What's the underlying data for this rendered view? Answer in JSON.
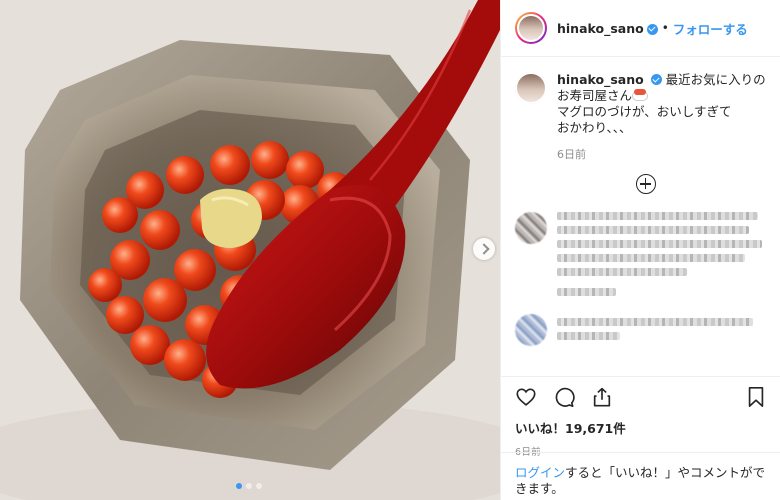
{
  "post": {
    "username": "hinako_sano",
    "follow_label": "フォローする",
    "separator": "•",
    "caption_line1": "最近お気に入りのお寿司屋さん",
    "caption_line2": "マグロのづけが、おいしすぎて",
    "caption_line3": "おかわり、、、",
    "caption_age": "6日前",
    "likes": "いいね！19,671件",
    "date": "6日前",
    "login_link": "ログイン",
    "login_text": "すると「いいね！」やコメントができます。",
    "carousel": {
      "total": 3,
      "current": 1
    }
  },
  "icons": {
    "verified": "verified-badge-icon",
    "like": "heart-icon",
    "comment": "comment-bubble-icon",
    "share": "share-icon",
    "save": "bookmark-icon",
    "load_more": "plus-circle-icon",
    "next": "chevron-right-icon"
  },
  "colors": {
    "accent": "#3897f0",
    "text": "#262626",
    "muted": "#8e8e8e",
    "border": "#efefef"
  }
}
